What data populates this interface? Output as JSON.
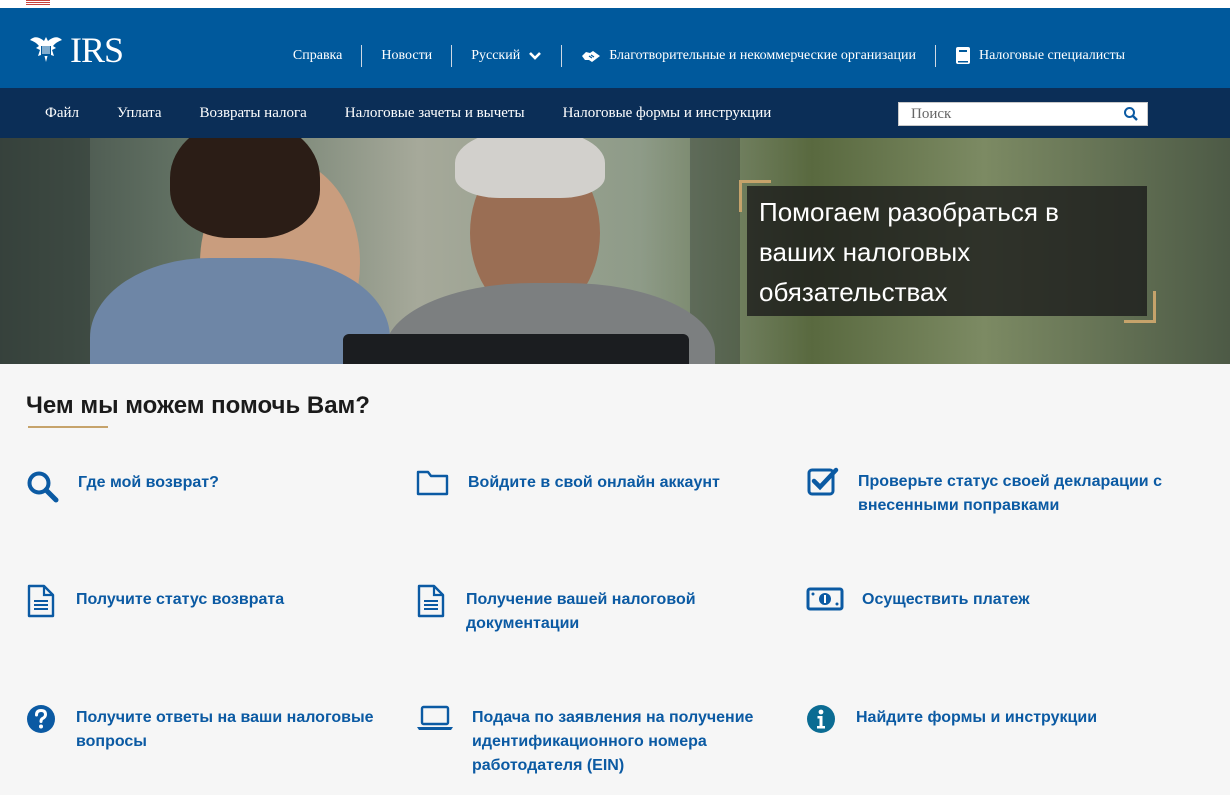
{
  "header": {
    "logo_text": "IRS",
    "utility": {
      "help": "Справка",
      "news": "Новости",
      "language": "Русский",
      "charities": "Благотворительные и некоммерческие организации",
      "tax_pros": "Налоговые специалисты"
    }
  },
  "nav": {
    "items": [
      "Файл",
      "Уплата",
      "Возвраты налога",
      "Налоговые зачеты и вычеты",
      "Налоговые формы и инструкции"
    ],
    "search_placeholder": "Поиск"
  },
  "hero": {
    "caption": "Помогаем разобраться в ваших налоговых обязательствах"
  },
  "help": {
    "title": "Чем мы можем помочь Вам?",
    "tiles": [
      {
        "label": "Где мой возврат?",
        "icon": "search-icon"
      },
      {
        "label": "Войдите в свой онлайн аккаунт",
        "icon": "folder-icon"
      },
      {
        "label": "Проверьте статус своей декларации с внесенными поправками",
        "icon": "checkbox-icon"
      },
      {
        "label": "Получите статус возврата",
        "icon": "document-icon"
      },
      {
        "label": "Получение вашей налоговой документации",
        "icon": "document-icon"
      },
      {
        "label": "Осуществить платеж",
        "icon": "money-icon"
      },
      {
        "label": "Получите ответы на ваши налоговые вопросы",
        "icon": "question-circle-icon"
      },
      {
        "label": "Подача по заявления на получение идентификационного номера работодателя (EIN)",
        "icon": "laptop-icon"
      },
      {
        "label": "Найдите формы и инструкции",
        "icon": "info-circle-icon"
      }
    ]
  },
  "colors": {
    "header_blue": "#00599c",
    "nav_navy": "#0b2e57",
    "link_blue": "#0b5aa3",
    "accent_gold": "#c6a36b"
  }
}
